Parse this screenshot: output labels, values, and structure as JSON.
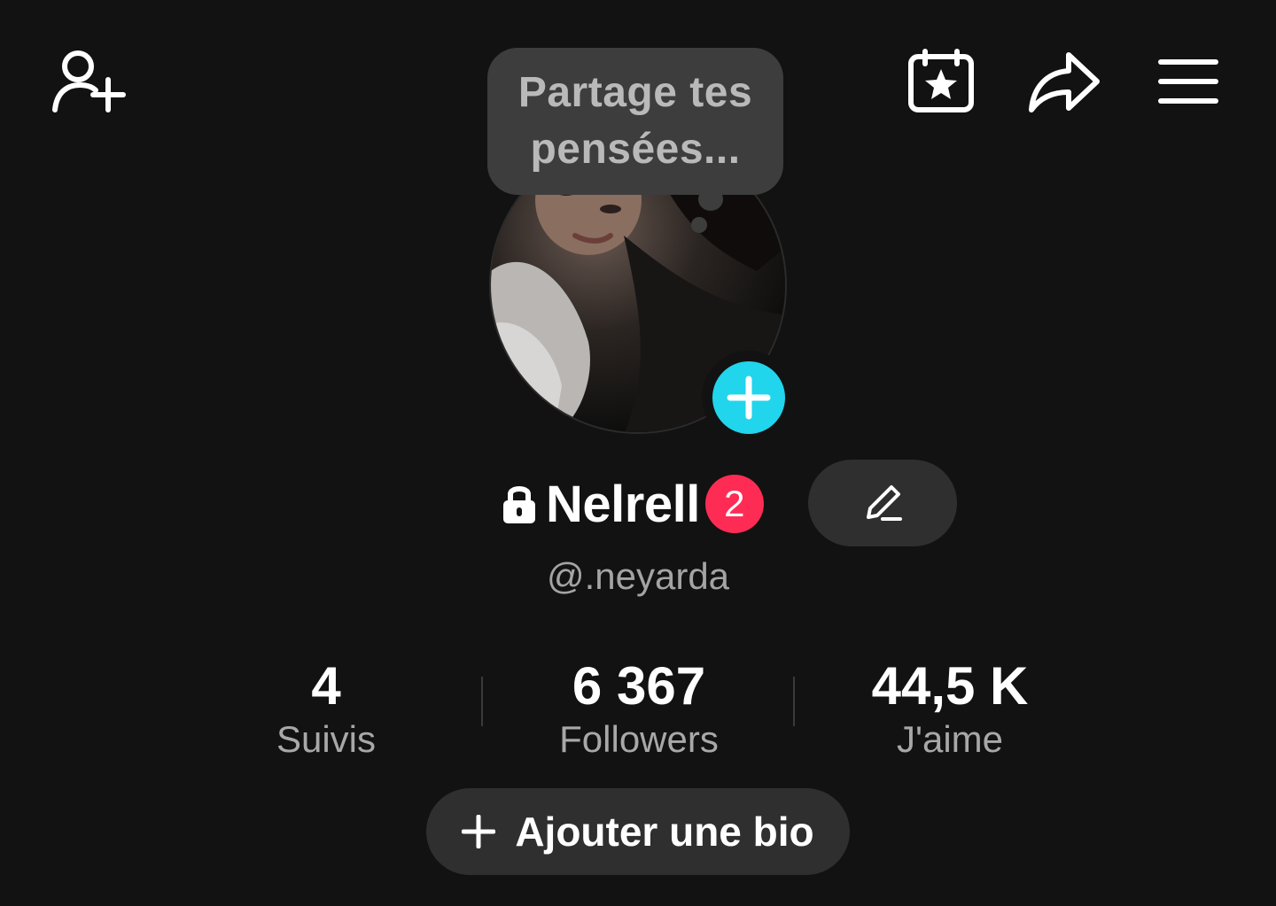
{
  "top_bar": {
    "add_friend_icon": "person-plus-icon",
    "calendar_icon": "calendar-star-icon",
    "share_icon": "share-arrow-icon",
    "menu_icon": "hamburger-menu-icon"
  },
  "thought_bubble": {
    "text": "Partage tes pensées..."
  },
  "profile": {
    "avatar_add_icon": "plus-icon",
    "lock_icon": "lock-icon",
    "display_name": "Nelrell",
    "notification_count": "2",
    "edit_icon": "pencil-icon",
    "handle": "@.neyarda"
  },
  "stats": [
    {
      "value": "4",
      "label": "Suivis"
    },
    {
      "value": "6 367",
      "label": "Followers"
    },
    {
      "value": "44,5 K",
      "label": "J'aime"
    }
  ],
  "bio_button": {
    "icon": "plus-icon",
    "label": "Ajouter une bio"
  },
  "colors": {
    "background": "#121212",
    "accent_cyan": "#20d5ec",
    "badge_red": "#fe2c55",
    "button_gray": "#2f2f2f"
  }
}
